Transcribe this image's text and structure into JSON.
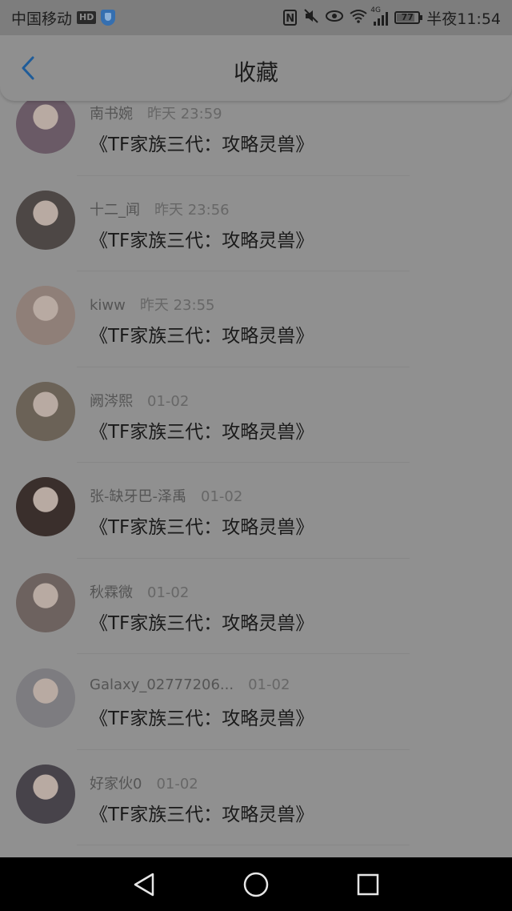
{
  "status_bar": {
    "carrier": "中国移动",
    "hd": "HD",
    "network_tag": "4G",
    "battery": "77",
    "time": "半夜11:54"
  },
  "header": {
    "title": "收藏"
  },
  "favorites": [
    {
      "name": "南书婉",
      "time": "昨天 23:59",
      "title": "《TF家族三代：攻略灵兽》",
      "avatar_color": "#6a5a66"
    },
    {
      "name": "十二_闻",
      "time": "昨天 23:56",
      "title": "《TF家族三代：攻略灵兽》",
      "avatar_color": "#4d4745"
    },
    {
      "name": "kiww",
      "time": "昨天 23:55",
      "title": "《TF家族三代：攻略灵兽》",
      "avatar_color": "#8f7f78"
    },
    {
      "name": "阙涔熙",
      "time": "01-02",
      "title": "《TF家族三代：攻略灵兽》",
      "avatar_color": "#6b6257"
    },
    {
      "name": "张-缺牙巴-泽禹",
      "time": "01-02",
      "title": "《TF家族三代：攻略灵兽》",
      "avatar_color": "#3a2f2c"
    },
    {
      "name": "秋霖微",
      "time": "01-02",
      "title": "《TF家族三代：攻略灵兽》",
      "avatar_color": "#6d625f"
    },
    {
      "name": "Galaxy_02777206...",
      "time": "01-02",
      "title": "《TF家族三代：攻略灵兽》",
      "avatar_color": "#7d7c80"
    },
    {
      "name": "好家伙0",
      "time": "01-02",
      "title": "《TF家族三代：攻略灵兽》",
      "avatar_color": "#47434a"
    }
  ],
  "colors": {
    "accent_blue": "#1f5c99",
    "overlay_gray": "#909090"
  }
}
